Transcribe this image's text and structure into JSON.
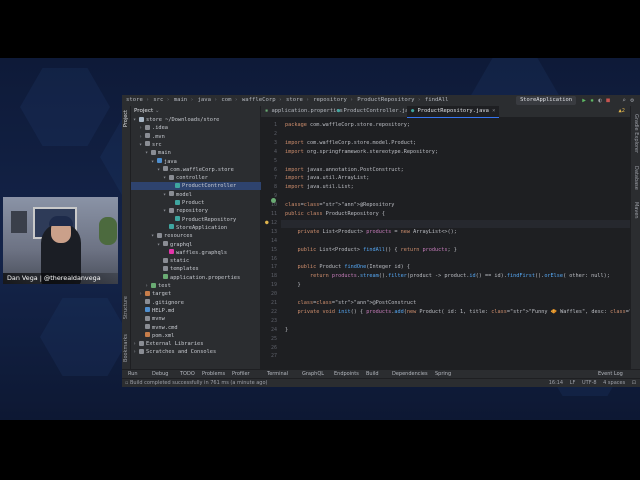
{
  "breadcrumb": [
    "store",
    "src",
    "main",
    "java",
    "com",
    "waffleCorp",
    "store",
    "repository",
    "ProductRepository",
    "findAll"
  ],
  "run_config": "StoreApplication",
  "project_panel": {
    "title": "Project",
    "tree": [
      {
        "label": "store ~/Downloads/store",
        "indent": 0,
        "arrow": "▾",
        "icon": "folder-icon",
        "color": "#a9b7c6"
      },
      {
        "label": ".idea",
        "indent": 1,
        "arrow": "›",
        "icon": "folder-icon",
        "color": "#8a8d94"
      },
      {
        "label": ".mvn",
        "indent": 1,
        "arrow": "›",
        "icon": "folder-icon",
        "color": "#8a8d94"
      },
      {
        "label": "src",
        "indent": 1,
        "arrow": "▾",
        "icon": "folder-icon",
        "color": "#8a8d94"
      },
      {
        "label": "main",
        "indent": 2,
        "arrow": "▾",
        "icon": "folder-icon",
        "color": "#8a8d94"
      },
      {
        "label": "java",
        "indent": 3,
        "arrow": "▾",
        "icon": "folder-icon",
        "color": "#4f8fcf"
      },
      {
        "label": "com.waffleCorp.store",
        "indent": 4,
        "arrow": "▾",
        "icon": "package-icon",
        "color": "#8a8d94"
      },
      {
        "label": "controller",
        "indent": 5,
        "arrow": "▾",
        "icon": "package-icon",
        "color": "#8a8d94"
      },
      {
        "label": "ProductController",
        "indent": 6,
        "arrow": "",
        "icon": "class-icon",
        "color": "#3fa6a0",
        "selected": true
      },
      {
        "label": "model",
        "indent": 5,
        "arrow": "▾",
        "icon": "package-icon",
        "color": "#8a8d94"
      },
      {
        "label": "Product",
        "indent": 6,
        "arrow": "",
        "icon": "record-icon",
        "color": "#3fa6a0"
      },
      {
        "label": "repository",
        "indent": 5,
        "arrow": "▾",
        "icon": "package-icon",
        "color": "#8a8d94"
      },
      {
        "label": "ProductRepository",
        "indent": 6,
        "arrow": "",
        "icon": "class-icon",
        "color": "#3fa6a0"
      },
      {
        "label": "StoreApplication",
        "indent": 5,
        "arrow": "",
        "icon": "class-icon",
        "color": "#3fa6a0"
      },
      {
        "label": "resources",
        "indent": 3,
        "arrow": "▾",
        "icon": "folder-icon",
        "color": "#8a8d94"
      },
      {
        "label": "graphql",
        "indent": 4,
        "arrow": "▾",
        "icon": "folder-icon",
        "color": "#8a8d94"
      },
      {
        "label": "waffles.graphqls",
        "indent": 5,
        "arrow": "",
        "icon": "graphql-file-icon",
        "color": "#e535ab"
      },
      {
        "label": "static",
        "indent": 4,
        "arrow": "",
        "icon": "folder-icon",
        "color": "#8a8d94"
      },
      {
        "label": "templates",
        "indent": 4,
        "arrow": "",
        "icon": "folder-icon",
        "color": "#8a8d94"
      },
      {
        "label": "application.properties",
        "indent": 4,
        "arrow": "",
        "icon": "properties-file-icon",
        "color": "#6aab73"
      },
      {
        "label": "test",
        "indent": 2,
        "arrow": "›",
        "icon": "folder-icon",
        "color": "#6aab73"
      },
      {
        "label": "target",
        "indent": 1,
        "arrow": "›",
        "icon": "folder-icon",
        "color": "#c77d4a"
      },
      {
        "label": ".gitignore",
        "indent": 1,
        "arrow": "",
        "icon": "file-icon",
        "color": "#8a8d94"
      },
      {
        "label": "HELP.md",
        "indent": 1,
        "arrow": "",
        "icon": "markdown-file-icon",
        "color": "#4f8fcf"
      },
      {
        "label": "mvnw",
        "indent": 1,
        "arrow": "",
        "icon": "file-icon",
        "color": "#8a8d94"
      },
      {
        "label": "mvnw.cmd",
        "indent": 1,
        "arrow": "",
        "icon": "file-icon",
        "color": "#8a8d94"
      },
      {
        "label": "pom.xml",
        "indent": 1,
        "arrow": "",
        "icon": "maven-file-icon",
        "color": "#c77d4a"
      },
      {
        "label": "External Libraries",
        "indent": 0,
        "arrow": "›",
        "icon": "library-icon",
        "color": "#8a8d94"
      },
      {
        "label": "Scratches and Consoles",
        "indent": 0,
        "arrow": "›",
        "icon": "scratch-icon",
        "color": "#8a8d94"
      }
    ]
  },
  "editor_tabs": [
    {
      "label": "application.properties",
      "active": false
    },
    {
      "label": "ProductController.java",
      "active": false
    },
    {
      "label": "ProductRepository.java",
      "active": true
    }
  ],
  "inspection_count": "2",
  "line_numbers": [
    "1",
    "2",
    "3",
    "4",
    "5",
    "6",
    "7",
    "8",
    "9",
    "10",
    "11",
    "12",
    "13",
    "14",
    "15",
    "16",
    "17",
    "18",
    "19",
    "20",
    "21",
    "22",
    "23",
    "24",
    "25",
    "26",
    "27"
  ],
  "code_lines": [
    "package com.waffleCorp.store.repository;",
    "",
    "import com.waffleCorp.store.model.Product;",
    "import org.springframework.stereotype.Repository;",
    "",
    "import javax.annotation.PostConstruct;",
    "import java.util.ArrayList;",
    "import java.util.List;",
    "",
    "@Repository",
    "public class ProductRepository {",
    "",
    "    private List<Product> products = new ArrayList<>();",
    "",
    "    public List<Product> findAll() { return products; }",
    "",
    "    public Product findOne(Integer id) {",
    "        return products.stream().filter(product -> product.id() == id).findFirst().orElse( other: null);",
    "    }",
    "",
    "    @PostConstruct",
    "    private void init() { products.add(new Product( id: 1, title: \"Funny 🧇 Waffles\", desc: \"These are the best waffles ev",
    "",
    "}",
    "",
    "",
    ""
  ],
  "right_strip": [
    "Gradle Explorer",
    "Database",
    "Maven"
  ],
  "left_strip": [
    "Project",
    "Structure",
    "Bookmarks"
  ],
  "bottom_tools": [
    "Run",
    "Debug",
    "TODO",
    "Problems",
    "Profiler",
    "Terminal",
    "GraphQL",
    "Endpoints",
    "Build",
    "Dependencies",
    "Spring",
    "Event Log"
  ],
  "status": {
    "message": "Build completed successfully in 761 ms (a minute ago)",
    "position": "16:14",
    "line_sep": "LF",
    "encoding": "UTF-8",
    "indent": "4 spaces"
  },
  "webcam": {
    "name_label": "Dan Vega | @therealdanvega"
  }
}
